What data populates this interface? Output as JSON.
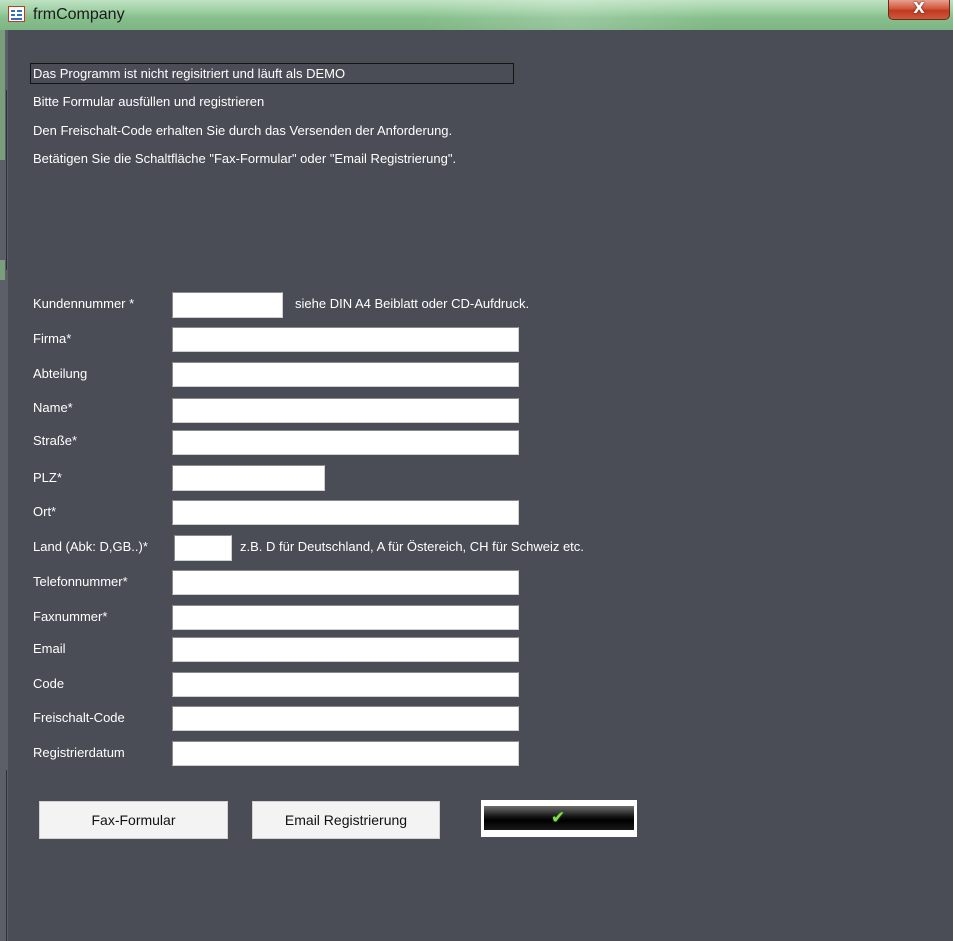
{
  "window": {
    "title": "frmCompany",
    "icon": "form-icon",
    "close_label": "X"
  },
  "info": {
    "line1": "Das Programm ist nicht regisitriert und läuft als DEMO",
    "line2": "Bitte Formular ausfüllen und registrieren",
    "line3": "Den Freischalt-Code erhalten Sie durch das Versenden der Anforderung.",
    "line4": "Betätigen Sie die Schaltfläche \"Fax-Formular\" oder \"Email Registrierung\"."
  },
  "form": {
    "kundennummer": {
      "label": "Kundennummer *",
      "value": "",
      "hint": "siehe DIN A4 Beiblatt oder CD-Aufdruck."
    },
    "firma": {
      "label": "Firma*",
      "value": ""
    },
    "abteilung": {
      "label": "Abteilung",
      "value": ""
    },
    "name": {
      "label": "Name*",
      "value": ""
    },
    "strasse": {
      "label": "Straße*",
      "value": ""
    },
    "plz": {
      "label": "PLZ*",
      "value": ""
    },
    "ort": {
      "label": "Ort*",
      "value": ""
    },
    "land": {
      "label": "Land (Abk: D,GB..)*",
      "value": "",
      "hint": "z.B. D für Deutschland, A für Östereich, CH für Schweiz etc."
    },
    "telefon": {
      "label": "Telefonnummer*",
      "value": ""
    },
    "fax": {
      "label": "Faxnummer*",
      "value": ""
    },
    "email": {
      "label": "Email",
      "value": ""
    },
    "code": {
      "label": "Code",
      "value": ""
    },
    "freischalt": {
      "label": "Freischalt-Code",
      "value": ""
    },
    "datum": {
      "label": "Registrierdatum",
      "value": ""
    }
  },
  "buttons": {
    "fax": "Fax-Formular",
    "email": "Email Registrierung",
    "confirm_icon": "checkmark-icon",
    "confirm_glyph": "✔"
  },
  "colors": {
    "background": "#4a4c56",
    "titlebar": "#9fd0a4",
    "close": "#c9482f",
    "check": "#7fe04a"
  }
}
